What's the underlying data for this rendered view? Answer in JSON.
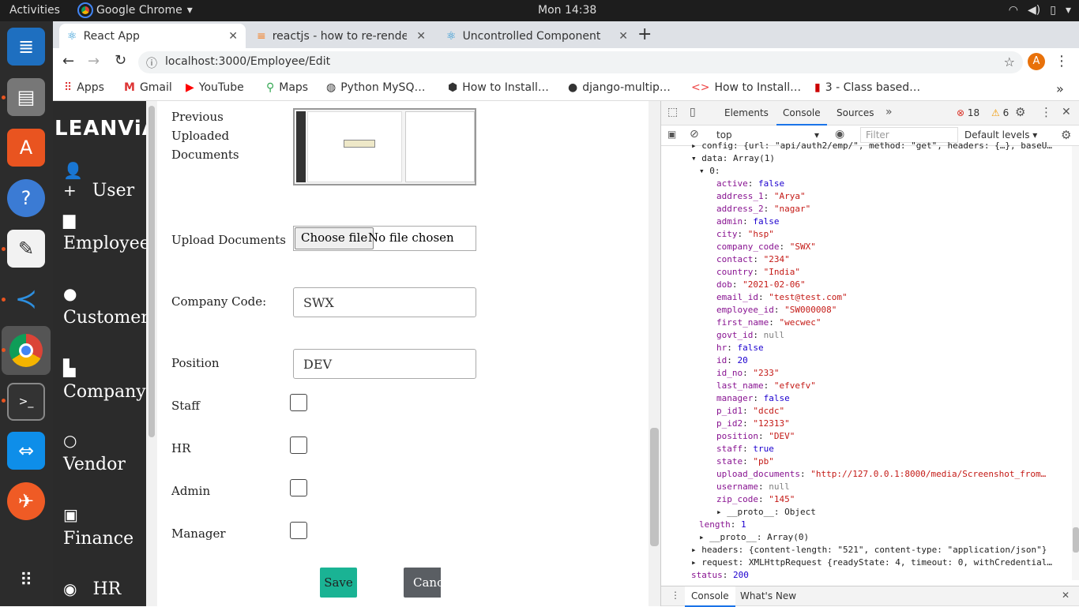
{
  "os": {
    "activities": "Activities",
    "app": "Google Chrome",
    "clock": "Mon 14:38"
  },
  "tabs": [
    {
      "title": "React App"
    },
    {
      "title": "reactjs - how to re-render"
    },
    {
      "title": "Uncontrolled Component"
    }
  ],
  "url": "localhost:3000/Employee/Edit",
  "profile": "A",
  "bookmarks": [
    "Apps",
    "Gmail",
    "YouTube",
    "Maps",
    "Python MySQ…",
    "How to Install…",
    "django-multip…",
    "How to Install…",
    "3 - Class based…"
  ],
  "app": {
    "logo": "LEANViA",
    "nav": [
      "User",
      "Employee",
      "Customer",
      "Company",
      "Vendor",
      "Finance",
      "HR"
    ],
    "form": {
      "prev_docs_label": "Previous Uploaded Documents",
      "upload_label": "Upload Documents",
      "choose_file": "Choose file",
      "no_file": "No file chosen",
      "company_code_label": "Company Code:",
      "company_code_value": "SWX",
      "position_label": "Position",
      "position_value": "DEV",
      "staff_label": "Staff",
      "hr_label": "HR",
      "admin_label": "Admin",
      "manager_label": "Manager",
      "save": "Save",
      "cancel": "Canc"
    }
  },
  "devtools": {
    "tabs": [
      "Elements",
      "Console",
      "Sources"
    ],
    "errors": "18",
    "warnings": "6",
    "context": "top",
    "filter_placeholder": "Filter",
    "levels": "Default levels",
    "drawer_tabs": [
      "Console",
      "What's New"
    ],
    "lines": [
      {
        "i": 0,
        "t": "▸ config: {url: \"api/auth2/emp/\", method: \"get\", headers: {…}, baseU…"
      },
      {
        "i": 0,
        "t": "▾ data: Array(1)"
      },
      {
        "i": 1,
        "t": "▾ 0:"
      },
      {
        "i": 2,
        "k": "active",
        "v": "false",
        "c": "n"
      },
      {
        "i": 2,
        "k": "address_1",
        "v": "\"Arya\"",
        "c": "s"
      },
      {
        "i": 2,
        "k": "address_2",
        "v": "\"nagar\"",
        "c": "s"
      },
      {
        "i": 2,
        "k": "admin",
        "v": "false",
        "c": "n"
      },
      {
        "i": 2,
        "k": "city",
        "v": "\"hsp\"",
        "c": "s"
      },
      {
        "i": 2,
        "k": "company_code",
        "v": "\"SWX\"",
        "c": "s"
      },
      {
        "i": 2,
        "k": "contact",
        "v": "\"234\"",
        "c": "s"
      },
      {
        "i": 2,
        "k": "country",
        "v": "\"India\"",
        "c": "s"
      },
      {
        "i": 2,
        "k": "dob",
        "v": "\"2021-02-06\"",
        "c": "s"
      },
      {
        "i": 2,
        "k": "email_id",
        "v": "\"test@test.com\"",
        "c": "s"
      },
      {
        "i": 2,
        "k": "employee_id",
        "v": "\"SW000008\"",
        "c": "s"
      },
      {
        "i": 2,
        "k": "first_name",
        "v": "\"wecwec\"",
        "c": "s"
      },
      {
        "i": 2,
        "k": "govt_id",
        "v": "null",
        "c": "g"
      },
      {
        "i": 2,
        "k": "hr",
        "v": "false",
        "c": "n"
      },
      {
        "i": 2,
        "k": "id",
        "v": "20",
        "c": "n"
      },
      {
        "i": 2,
        "k": "id_no",
        "v": "\"233\"",
        "c": "s"
      },
      {
        "i": 2,
        "k": "last_name",
        "v": "\"efvefv\"",
        "c": "s"
      },
      {
        "i": 2,
        "k": "manager",
        "v": "false",
        "c": "n"
      },
      {
        "i": 2,
        "k": "p_id1",
        "v": "\"dcdc\"",
        "c": "s"
      },
      {
        "i": 2,
        "k": "p_id2",
        "v": "\"12313\"",
        "c": "s"
      },
      {
        "i": 2,
        "k": "position",
        "v": "\"DEV\"",
        "c": "s"
      },
      {
        "i": 2,
        "k": "staff",
        "v": "true",
        "c": "n"
      },
      {
        "i": 2,
        "k": "state",
        "v": "\"pb\"",
        "c": "s"
      },
      {
        "i": 2,
        "k": "upload_documents",
        "v": "\"http://127.0.0.1:8000/media/Screenshot_from…",
        "c": "s"
      },
      {
        "i": 2,
        "k": "username",
        "v": "null",
        "c": "g"
      },
      {
        "i": 2,
        "k": "zip_code",
        "v": "\"145\"",
        "c": "s"
      },
      {
        "i": 2,
        "t": "▸ __proto__: Object"
      },
      {
        "i": 1,
        "k": "length",
        "v": "1",
        "c": "n"
      },
      {
        "i": 1,
        "t": "▸ __proto__: Array(0)"
      },
      {
        "i": 0,
        "t": "▸ headers: {content-length: \"521\", content-type: \"application/json\"}"
      },
      {
        "i": 0,
        "t": "▸ request: XMLHttpRequest {readyState: 4, timeout: 0, withCredential…"
      },
      {
        "i": 0,
        "k": "status",
        "v": "200",
        "c": "n"
      }
    ]
  }
}
